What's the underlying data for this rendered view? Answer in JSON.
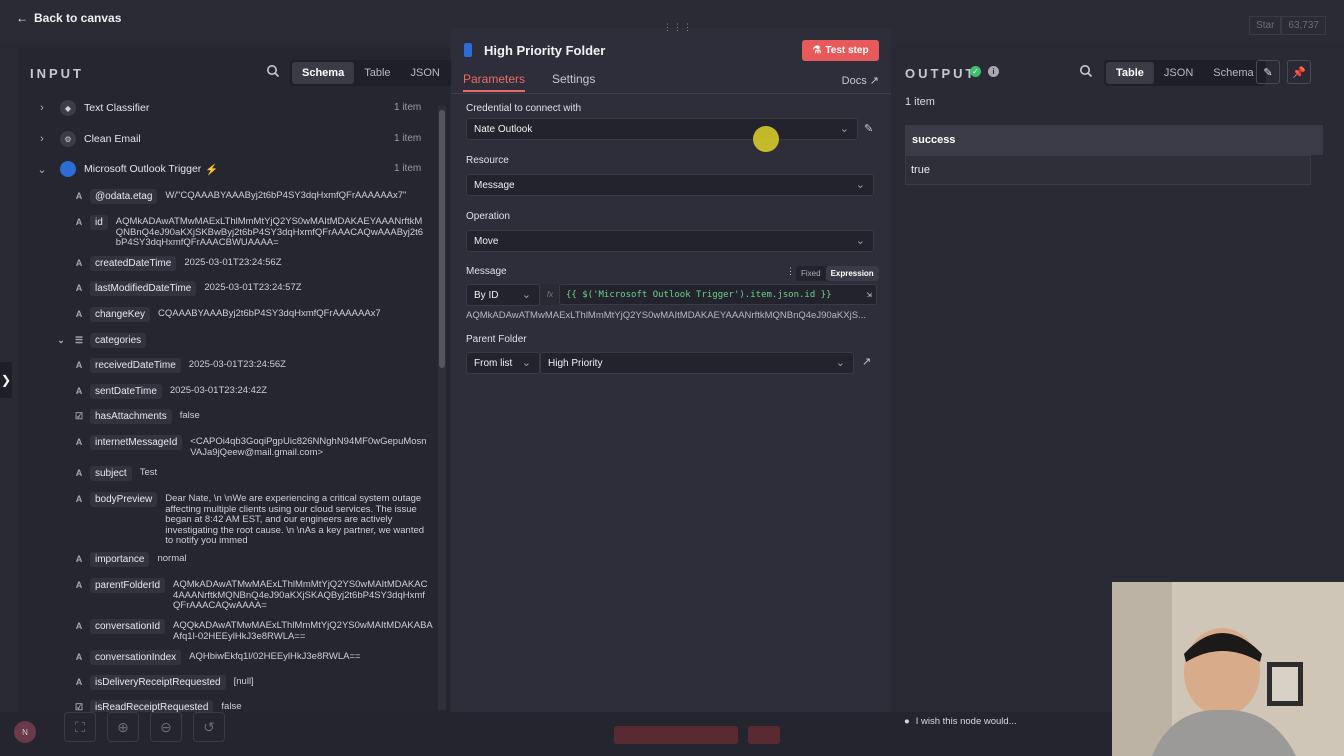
{
  "topbar": {
    "back_label": "Back to canvas",
    "github_star": "Star",
    "github_count": "63,737"
  },
  "input": {
    "title": "INPUT",
    "view_tabs": [
      "Schema",
      "Table",
      "JSON"
    ],
    "active_tab": "Schema",
    "nodes": [
      {
        "name": "Text Classifier",
        "count": "1 item"
      },
      {
        "name": "Clean Email",
        "count": "1 item"
      },
      {
        "name": "Microsoft Outlook Trigger",
        "count": "1 item"
      }
    ],
    "fields": [
      {
        "type": "A",
        "name": "@odata.etag",
        "value": "W/\"CQAAABYAAAByj2t6bP4SY3dqHxmfQFrAAAAAAx7\""
      },
      {
        "type": "A",
        "name": "id",
        "value": "AQMkADAwATMwMAExLThlMmMtYjQ2YS0wMAItMDAKAEYAAANrftkMQNBnQ4eJ90aKXjSKBwByj2t6bP4SY3dqHxmfQFrAAACAQwAAAByj2t6bP4SY3dqHxmfQFrAAACBWUAAAA="
      },
      {
        "type": "A",
        "name": "createdDateTime",
        "value": "2025-03-01T23:24:56Z"
      },
      {
        "type": "A",
        "name": "lastModifiedDateTime",
        "value": "2025-03-01T23:24:57Z"
      },
      {
        "type": "A",
        "name": "changeKey",
        "value": "CQAAABYAAAByj2t6bP4SY3dqHxmfQFrAAAAAAx7"
      },
      {
        "type": "list",
        "name": "categories",
        "value": ""
      },
      {
        "type": "A",
        "name": "receivedDateTime",
        "value": "2025-03-01T23:24:56Z"
      },
      {
        "type": "A",
        "name": "sentDateTime",
        "value": "2025-03-01T23:24:42Z"
      },
      {
        "type": "bool",
        "name": "hasAttachments",
        "value": "false"
      },
      {
        "type": "A",
        "name": "internetMessageId",
        "value": "<CAPOi4qb3GoqiPgpUic826NNghN94MF0wGepuMosnVAJa9jQeew@mail.gmail.com>"
      },
      {
        "type": "A",
        "name": "subject",
        "value": "Test"
      },
      {
        "type": "A",
        "name": "bodyPreview",
        "value": "Dear Nate, \\n \\nWe are experiencing a critical system outage affecting multiple clients using our cloud services. The issue began at 8:42 AM EST, and our engineers are actively investigating the root cause. \\n \\nAs a key partner, we wanted to notify you immed"
      },
      {
        "type": "A",
        "name": "importance",
        "value": "normal"
      },
      {
        "type": "A",
        "name": "parentFolderId",
        "value": "AQMkADAwATMwMAExLThlMmMtYjQ2YS0wMAItMDAKAC4AAANrftkMQNBnQ4eJ90aKXjSKAQByj2t6bP4SY3dqHxmfQFrAAACAQwAAAA="
      },
      {
        "type": "A",
        "name": "conversationId",
        "value": "AQQkADAwATMwMAExLThlMmMtYjQ2YS0wMAItMDAKABAAfq1l-02HEEylHkJ3e8RWLA=="
      },
      {
        "type": "A",
        "name": "conversationIndex",
        "value": "AQHbiwEkfq1l/02HEEylHkJ3e8RWLA=="
      },
      {
        "type": "A",
        "name": "isDeliveryReceiptRequested",
        "value": "[null]"
      },
      {
        "type": "bool",
        "name": "isReadReceiptRequested",
        "value": "false"
      }
    ]
  },
  "node": {
    "title": "High Priority Folder",
    "test_button": "Test step",
    "tabs": [
      "Parameters",
      "Settings"
    ],
    "docs": "Docs",
    "credential_label": "Credential to connect with",
    "credential_value": "Nate Outlook",
    "resource_label": "Resource",
    "resource_value": "Message",
    "operation_label": "Operation",
    "operation_value": "Move",
    "message_label": "Message",
    "mode_fixed": "Fixed",
    "mode_expression": "Expression",
    "message_by": "By ID",
    "fx": "fx",
    "expression": "{{ $('Microsoft Outlook Trigger').item.json.id }}",
    "expression_result": "AQMkADAwATMwMAExLThlMmMtYjQ2YS0wMAItMDAKAEYAAANrftkMQNBnQ4eJ90aKXjS...",
    "parent_folder_label": "Parent Folder",
    "parent_mode": "From list",
    "parent_value": "High Priority"
  },
  "output": {
    "title": "OUTPUT",
    "view_tabs": [
      "Table",
      "JSON",
      "Schema"
    ],
    "active_tab": "Table",
    "items_count": "1 item",
    "column": "success",
    "value": "true"
  },
  "hint": "I wish this node would...",
  "colors": {
    "accent": "#ea6b6b",
    "test_button": "#e85a5a",
    "success": "#3fbf6a",
    "expression": "#6fd08c"
  }
}
